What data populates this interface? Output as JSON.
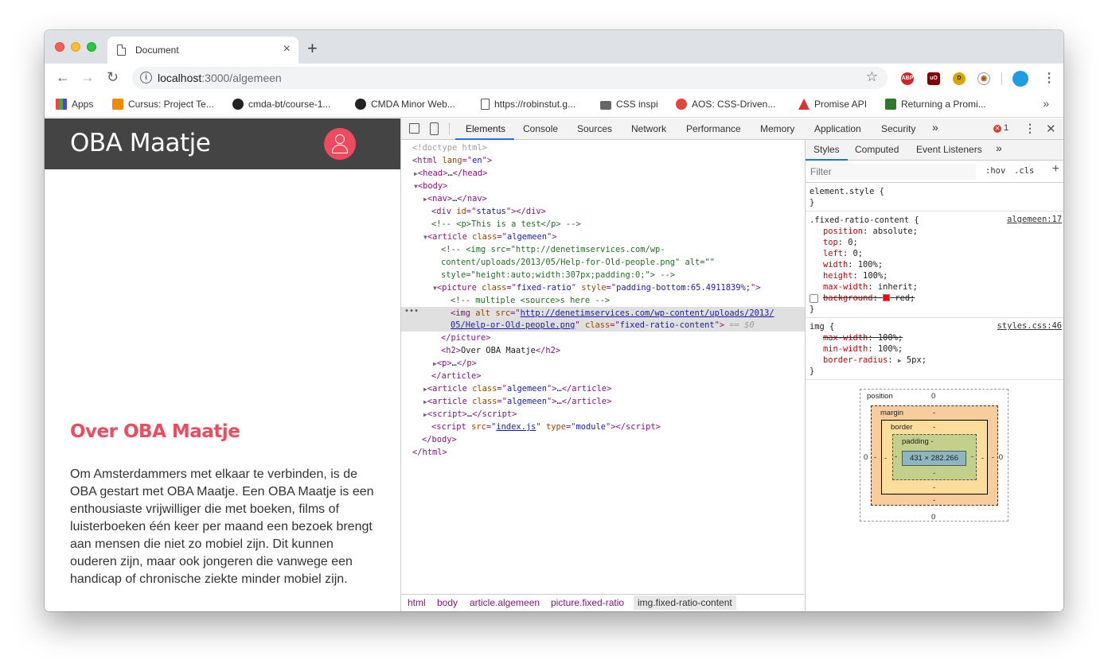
{
  "browser": {
    "tab_title": "Document",
    "close_glyph": "×",
    "newtab_glyph": "+",
    "back_glyph": "←",
    "forward_glyph": "→",
    "reload_glyph": "↻",
    "url_host": "localhost",
    "url_path": ":3000/algemeen",
    "star_glyph": "☆",
    "kebab_glyph": "⋮",
    "extensions": [
      "ABP",
      "uO",
      "D",
      "◉"
    ],
    "bookmarks": [
      "Apps",
      "Cursus: Project Te...",
      "cmda-bt/course-1...",
      "CMDA Minor Web...",
      "https://robinstut.g...",
      "CSS inspi",
      "AOS: CSS-Driven...",
      "Promise API",
      "Returning a Promi..."
    ],
    "bookmarks_more": "»"
  },
  "site": {
    "title": "OBA Maatje",
    "heading": "Over OBA Maatje",
    "paragraph": "Om Amsterdammers met elkaar te verbinden, is de OBA gestart met OBA Maatje. Een OBA Maatje is een enthousiaste vrijwilliger die met boeken, films of luisterboeken één keer per maand een bezoek brengt aan mensen die niet zo mobiel zijn. Dit kunnen ouderen zijn, maar ook jongeren die vanwege een handicap of chronische ziekte minder mobiel zijn.",
    "accent": "#f04a5e",
    "header_bg": "#444444"
  },
  "devtools": {
    "tabs": [
      "Elements",
      "Console",
      "Sources",
      "Network",
      "Performance",
      "Memory",
      "Application",
      "Security"
    ],
    "more_glyph": "»",
    "error_count": "1",
    "close_glyph": "✕",
    "kebab_glyph": "⋮",
    "breadcrumbs": [
      "html",
      "body",
      "article.algemeen",
      "picture.fixed-ratio",
      "img.fixed-ratio-content"
    ],
    "styles_tabs": [
      "Styles",
      "Computed",
      "Event Listeners"
    ],
    "filter_placeholder": "Filter",
    "hov": ":hov",
    "cls": ".cls",
    "plus": "+",
    "rules": {
      "element_style": "element.style {",
      "close_brace": "}",
      "fixed_selector": ".fixed-ratio-content {",
      "fixed_source": "algemeen:17",
      "img_selector": "img {",
      "img_source": "styles.css:46"
    },
    "box_model": {
      "position_label": "position",
      "margin_label": "margin",
      "border_label": "border",
      "padding_label": "padding -",
      "content": "431 × 282.266",
      "zero": "0",
      "dash": "-"
    }
  }
}
